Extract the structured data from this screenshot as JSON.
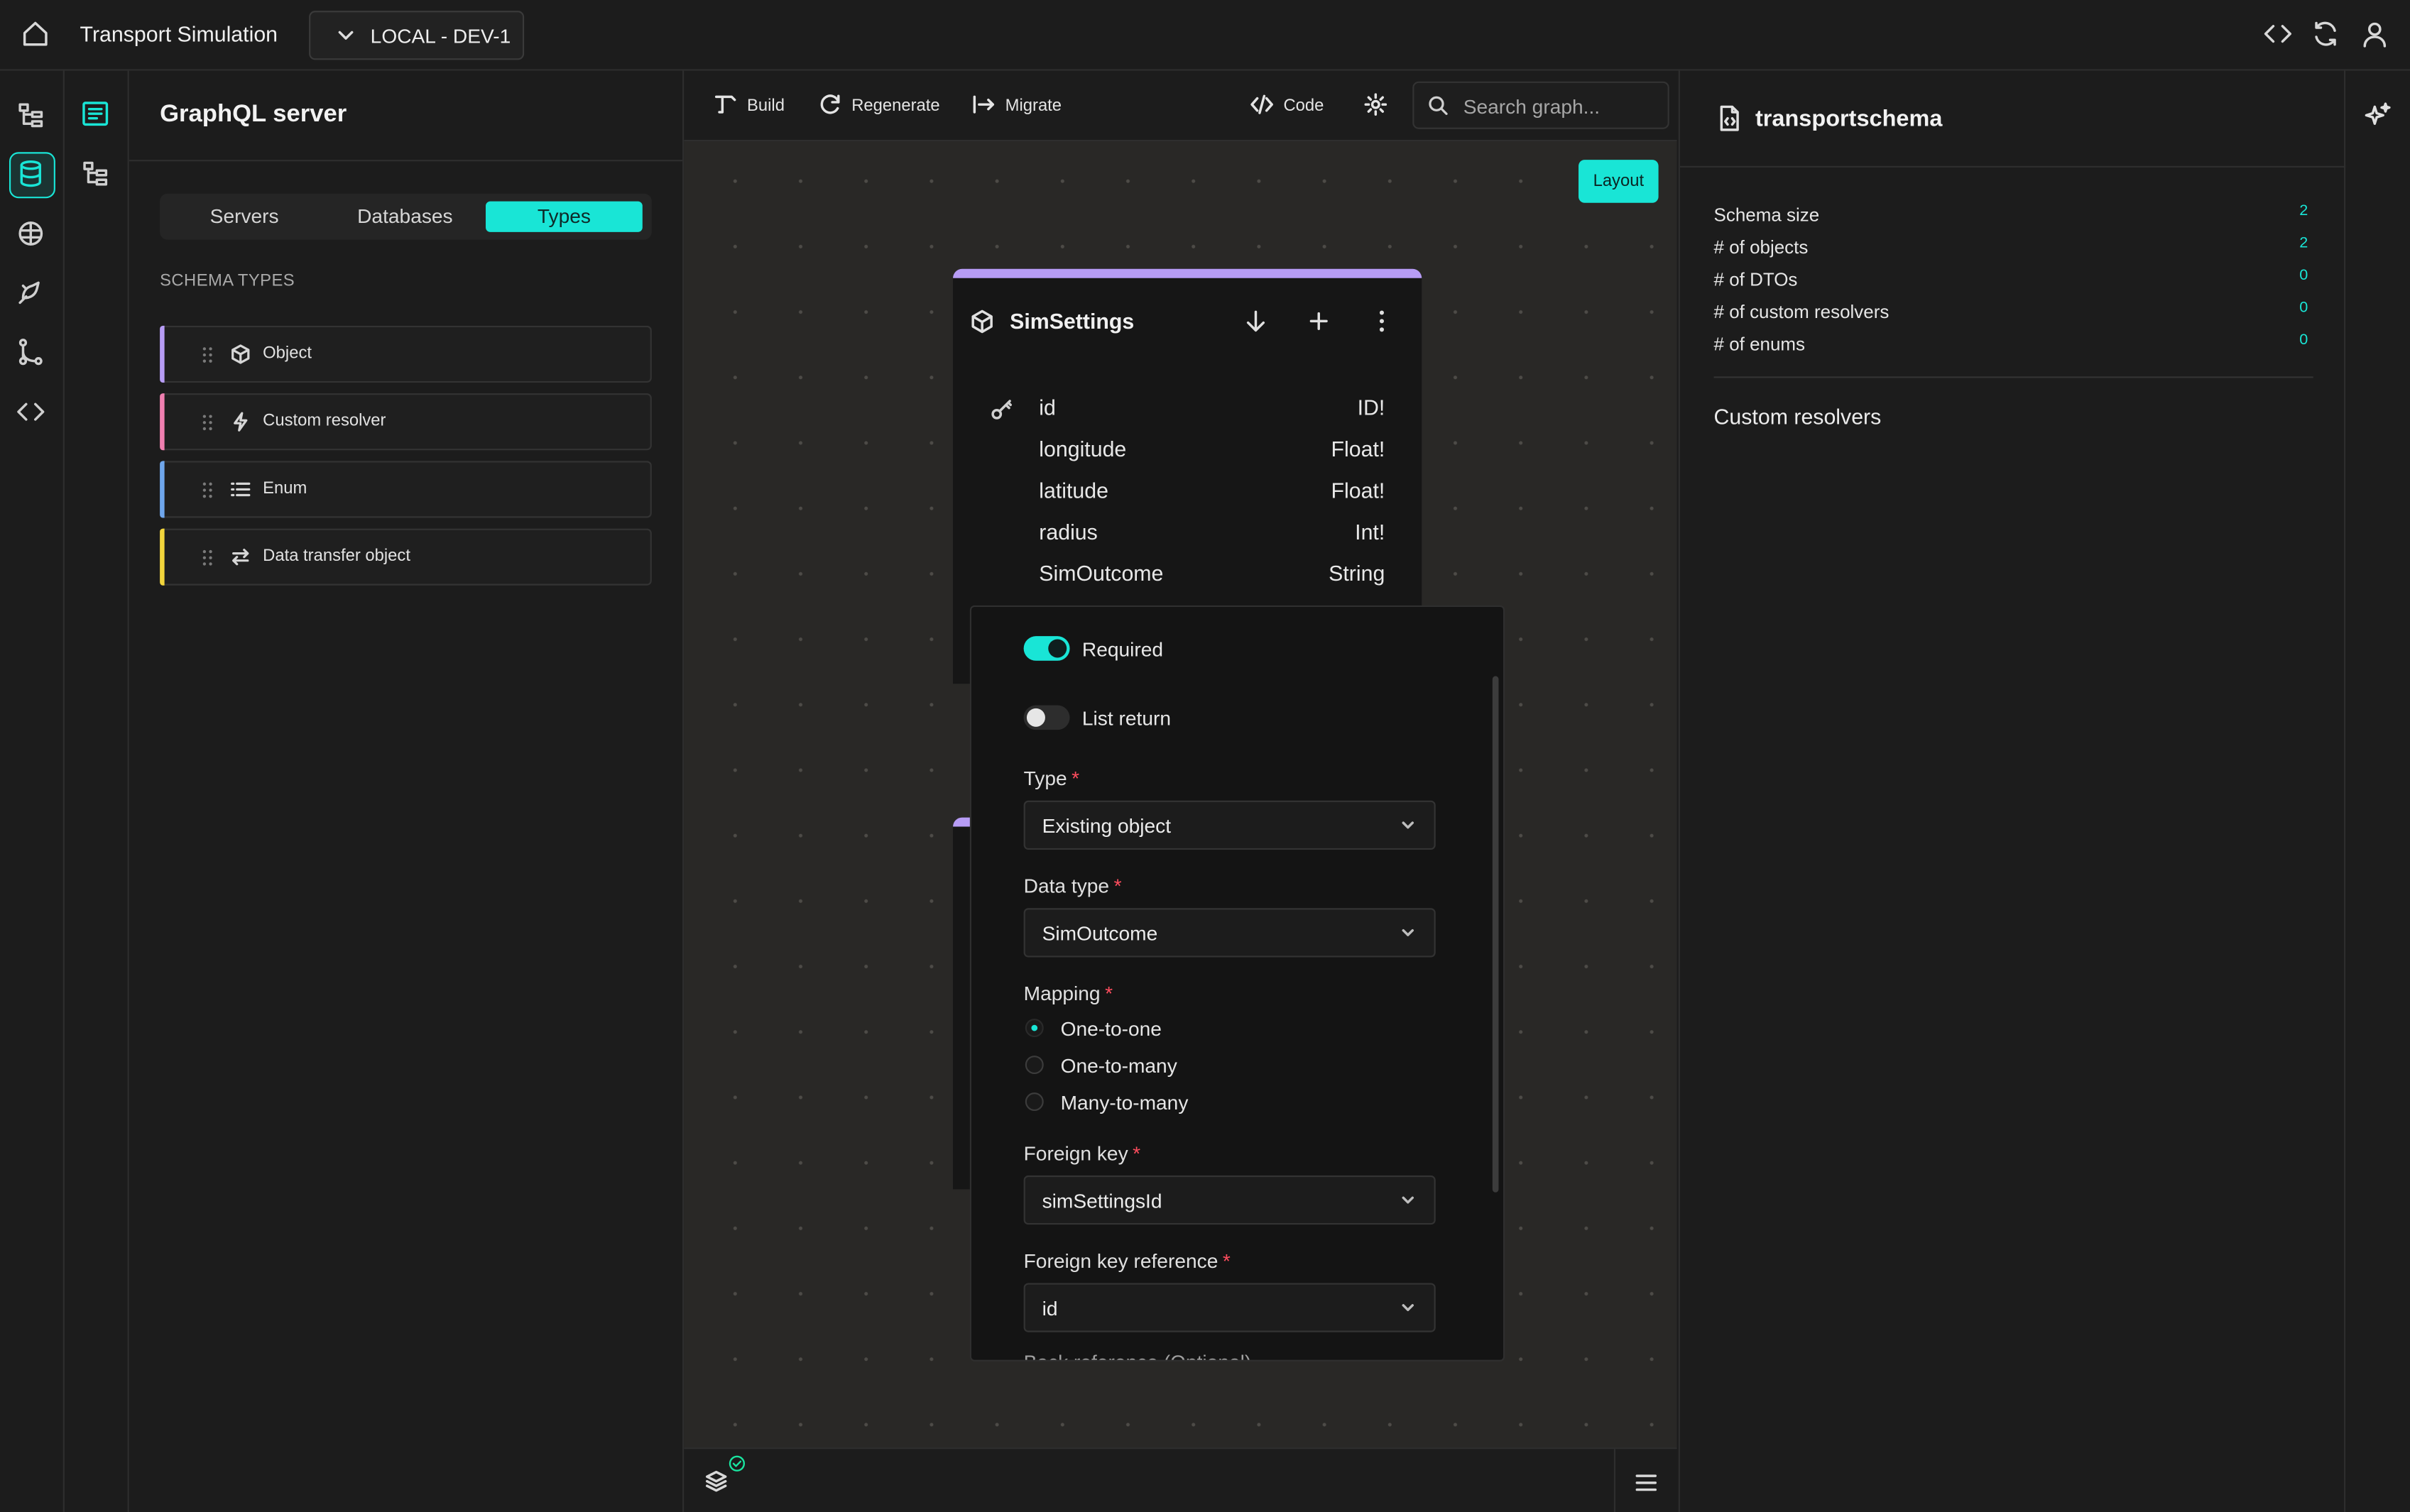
{
  "app": {
    "title": "Transport Simulation",
    "environment": "LOCAL - DEV-1"
  },
  "left_panel": {
    "title": "GraphQL server",
    "tabs": [
      "Servers",
      "Databases",
      "Types"
    ],
    "active_tab": "Types",
    "section_label": "SCHEMA TYPES",
    "schema_types": [
      {
        "label": "Object",
        "icon": "cube-icon",
        "color": "#b79cf5"
      },
      {
        "label": "Custom resolver",
        "icon": "lightning-icon",
        "color": "#f07fb0"
      },
      {
        "label": "Enum",
        "icon": "list-icon",
        "color": "#6fa6ec"
      },
      {
        "label": "Data transfer object",
        "icon": "arrows-exchange-icon",
        "color": "#f2d53c"
      }
    ]
  },
  "toolbar": {
    "build": "Build",
    "regenerate": "Regenerate",
    "migrate": "Migrate",
    "code": "Code",
    "search_placeholder": "Search graph...",
    "layout": "Layout"
  },
  "node": {
    "title": "SimSettings",
    "fields": [
      {
        "name": "id",
        "type": "ID!"
      },
      {
        "name": "longitude",
        "type": "Float!"
      },
      {
        "name": "latitude",
        "type": "Float!"
      },
      {
        "name": "radius",
        "type": "Int!"
      },
      {
        "name": "SimOutcome",
        "type": "String"
      }
    ]
  },
  "field_form": {
    "required_label": "Required",
    "required_on": true,
    "list_return_label": "List return",
    "list_return_on": false,
    "type_label": "Type",
    "type_value": "Existing object",
    "data_type_label": "Data type",
    "data_type_value": "SimOutcome",
    "mapping_label": "Mapping",
    "mapping_options": [
      "One-to-one",
      "One-to-many",
      "Many-to-many"
    ],
    "mapping_selected": "One-to-one",
    "foreign_key_label": "Foreign key",
    "foreign_key_value": "simSettingsId",
    "foreign_key_ref_label": "Foreign key reference",
    "foreign_key_ref_value": "id",
    "cut_off_label": "Back reference (Optional)"
  },
  "right_panel": {
    "title": "transportschema",
    "stats": [
      {
        "label": "Schema size",
        "value": "2"
      },
      {
        "label": "# of objects",
        "value": "2"
      },
      {
        "label": "# of DTOs",
        "value": "0"
      },
      {
        "label": "# of custom resolvers",
        "value": "0"
      },
      {
        "label": "# of enums",
        "value": "0"
      }
    ],
    "custom_resolvers_heading": "Custom resolvers"
  },
  "colors": {
    "accent": "#19e5d6",
    "object": "#b79cf5",
    "required_star": "#ff4d5e"
  }
}
